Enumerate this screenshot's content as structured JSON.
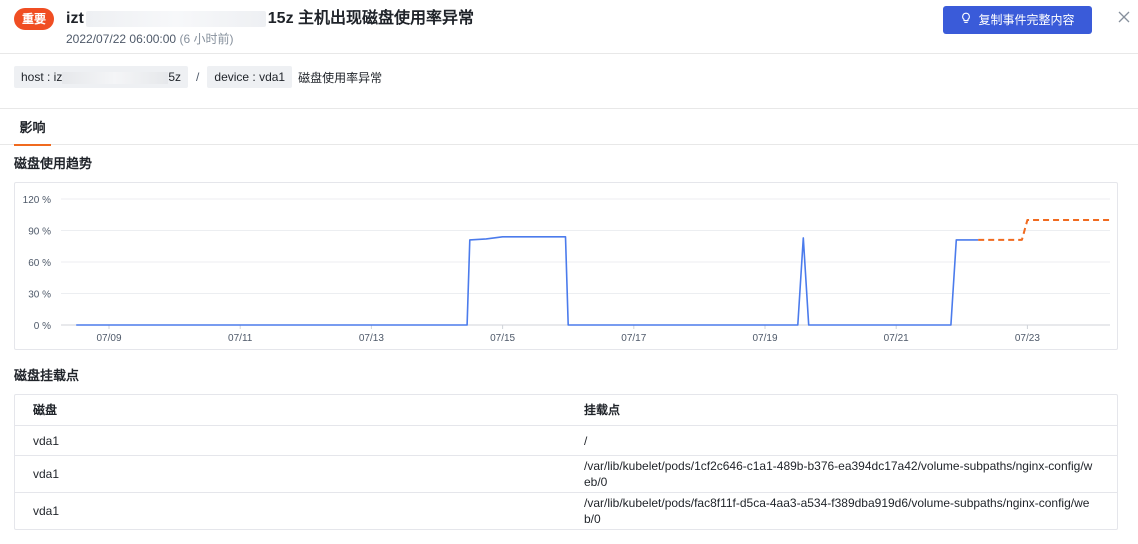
{
  "header": {
    "severity": "重要",
    "title_prefix": "izt",
    "title_suffix": "15z 主机出现磁盘使用率异常",
    "time": "2022/07/22 06:00:00",
    "relative_time": "(6 小时前)",
    "copy_button": "复制事件完整内容"
  },
  "tags": {
    "host_label": "host : iz",
    "host_suffix": "5z",
    "separator": "/",
    "device": "device : vda1",
    "metric": "磁盘使用率异常"
  },
  "tabs": [
    "影响"
  ],
  "sections": {
    "trend_title": "磁盘使用趋势",
    "mount_title": "磁盘挂载点"
  },
  "chart_data": {
    "type": "line",
    "title": "",
    "ylim": [
      0,
      120
    ],
    "y_ticks": [
      "120 %",
      "90 %",
      "60 %",
      "30 %",
      "0 %"
    ],
    "x_ticks": [
      "07/09",
      "07/11",
      "07/13",
      "07/15",
      "07/17",
      "07/19",
      "07/21",
      "07/23"
    ],
    "grid": true,
    "legend": "none",
    "series": [
      {
        "style": "solid",
        "color": "#4b7bec",
        "points": [
          [
            "07/08 12:00",
            0
          ],
          [
            "07/14 11:00",
            0
          ],
          [
            "07/14 12:00",
            81
          ],
          [
            "07/14 18:00",
            82
          ],
          [
            "07/15 00:00",
            84
          ],
          [
            "07/15 12:00",
            84
          ],
          [
            "07/15 18:00",
            84
          ],
          [
            "07/15 23:00",
            84
          ],
          [
            "07/16 00:00",
            0
          ],
          [
            "07/19 12:00",
            0
          ],
          [
            "07/19 14:00",
            83
          ],
          [
            "07/19 16:00",
            0
          ],
          [
            "07/21 20:00",
            0
          ],
          [
            "07/21 22:00",
            81
          ],
          [
            "07/22 06:00",
            81
          ]
        ]
      },
      {
        "style": "dashed",
        "color": "#f06a1f",
        "points": [
          [
            "07/22 06:00",
            81
          ],
          [
            "07/22 22:00",
            81
          ],
          [
            "07/23 00:00",
            100
          ],
          [
            "07/24 06:00",
            100
          ]
        ]
      }
    ]
  },
  "table": {
    "columns": [
      "磁盘",
      "挂载点"
    ],
    "rows": [
      [
        "vda1",
        "/"
      ],
      [
        "vda1",
        "/var/lib/kubelet/pods/1cf2c646-c1a1-489b-b376-ea394dc17a42/volume-subpaths/nginx-config/web/0"
      ],
      [
        "vda1",
        "/var/lib/kubelet/pods/fac8f11f-d5ca-4aa3-a534-f389dba919d6/volume-subpaths/nginx-config/web/0"
      ]
    ]
  },
  "colors": {
    "accent": "#3a5bd9",
    "severity": "#f04e23",
    "tab_underline": "#f06a1f",
    "actual_line": "#4b7bec",
    "forecast_line": "#f06a1f"
  },
  "icons": {
    "copy": "lightbulb-icon",
    "close": "close-icon"
  }
}
